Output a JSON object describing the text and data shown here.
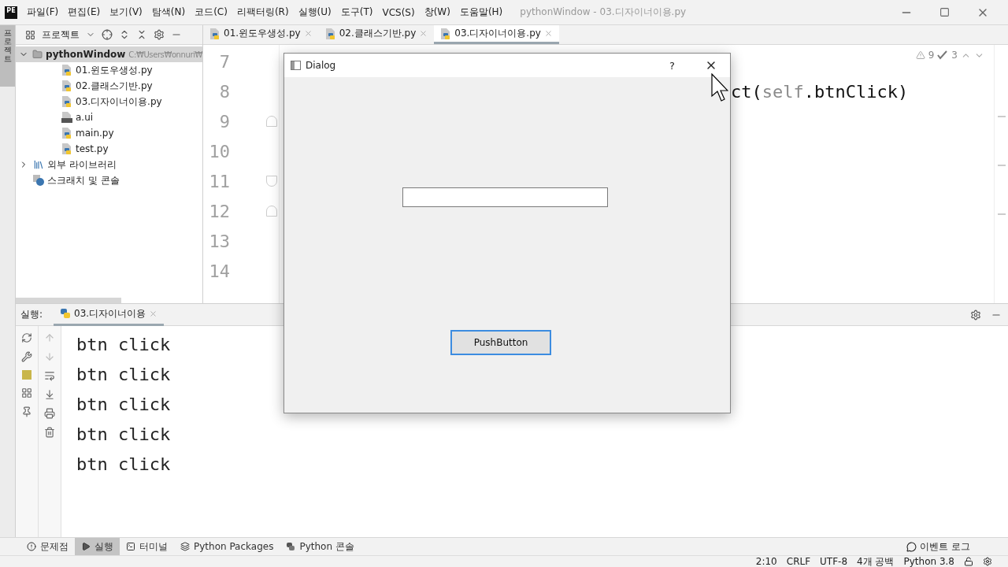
{
  "window": {
    "logo": "PE",
    "title": "pythonWindow - 03.디자이너이용.py"
  },
  "menu": [
    "파일(F)",
    "편집(E)",
    "보기(V)",
    "탐색(N)",
    "코드(C)",
    "리팩터링(R)",
    "실행(U)",
    "도구(T)",
    "VCS(S)",
    "창(W)",
    "도움말(H)"
  ],
  "side_tab": "프로젝트",
  "project_panel": {
    "title": "프로젝트",
    "tree": [
      {
        "label": "pythonWindow",
        "path": "C:₩Users₩onnuri₩",
        "kind": "folder",
        "expanded": true,
        "children": [
          {
            "label": "01.윈도우생성.py",
            "kind": "python"
          },
          {
            "label": "02.클래스기반.py",
            "kind": "python"
          },
          {
            "label": "03.디자이너이용.py",
            "kind": "python"
          },
          {
            "label": "a.ui",
            "kind": "qt"
          },
          {
            "label": "main.py",
            "kind": "python"
          },
          {
            "label": "test.py",
            "kind": "python"
          }
        ]
      },
      {
        "label": "외부 라이브러리",
        "kind": "library",
        "expanded": false
      },
      {
        "label": "스크래치 및 콘솔",
        "kind": "scratch"
      }
    ]
  },
  "editor_tabs": [
    {
      "label": "01.윈도우생성.py",
      "selected": false
    },
    {
      "label": "02.클래스기반.py",
      "selected": false
    },
    {
      "label": "03.디자이너이용.py",
      "selected": true
    }
  ],
  "editor": {
    "inspections": {
      "warnings": "9",
      "weak_warnings": "3"
    },
    "lines": [
      {
        "number": "7"
      },
      {
        "number": "8",
        "code": [
          {
            "text": "ct(",
            "kind": "plain"
          },
          {
            "text": "self",
            "kind": "self"
          },
          {
            "text": ".btnClick)",
            "kind": "plain"
          }
        ]
      },
      {
        "number": "9",
        "fold_start": true
      },
      {
        "number": "10"
      },
      {
        "number": "11",
        "fold_end": true
      },
      {
        "number": "12",
        "fold_start": true
      },
      {
        "number": "13"
      },
      {
        "number": "14"
      }
    ]
  },
  "run_panel": {
    "label": "실행:",
    "tabs": [
      {
        "label": "03.디자이너이용",
        "selected": true
      }
    ],
    "output": [
      "btn click",
      "btn click",
      "btn click",
      "btn click",
      "btn click"
    ]
  },
  "tool_windows": [
    {
      "label": "문제점",
      "kind": "problems",
      "selected": false
    },
    {
      "label": "실행",
      "kind": "run",
      "selected": true
    },
    {
      "label": "터미널",
      "kind": "terminal",
      "selected": false
    },
    {
      "label": "Python Packages",
      "kind": "packages",
      "selected": false
    },
    {
      "label": "Python 콘솔",
      "kind": "console",
      "selected": false
    }
  ],
  "event_log": "이벤트 로그",
  "status_bar": {
    "position": "2:10",
    "line_separator": "CRLF",
    "encoding": "UTF-8",
    "indent": "4개 공백",
    "interpreter": "Python 3.8"
  },
  "dialog": {
    "title": "Dialog",
    "help": "?",
    "button": "PushButton"
  }
}
